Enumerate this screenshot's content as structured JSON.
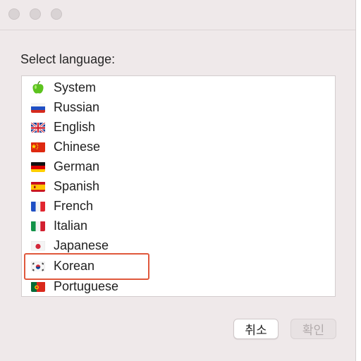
{
  "dialog": {
    "prompt": "Select language:",
    "languages": [
      {
        "label": "System",
        "icon": "apple-icon"
      },
      {
        "label": "Russian",
        "icon": "russia-flag-icon"
      },
      {
        "label": "English",
        "icon": "uk-flag-icon"
      },
      {
        "label": "Chinese",
        "icon": "china-flag-icon"
      },
      {
        "label": "German",
        "icon": "germany-flag-icon"
      },
      {
        "label": "Spanish",
        "icon": "spain-flag-icon"
      },
      {
        "label": "French",
        "icon": "france-flag-icon"
      },
      {
        "label": "Italian",
        "icon": "italy-flag-icon"
      },
      {
        "label": "Japanese",
        "icon": "japan-flag-icon"
      },
      {
        "label": "Korean",
        "icon": "korea-flag-icon"
      },
      {
        "label": "Portuguese",
        "icon": "portugal-flag-icon"
      }
    ],
    "highlighted": "Korean",
    "cancel_label": "취소",
    "ok_label": "확인"
  },
  "colors": {
    "window_bg": "#efe9ea",
    "highlight_border": "#e0583c",
    "ok_disabled_text": "#b2abac"
  }
}
